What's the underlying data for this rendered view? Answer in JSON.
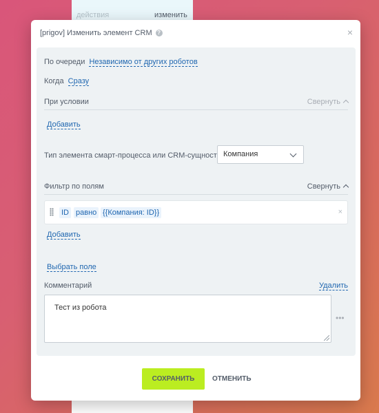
{
  "background": {
    "actions_label": "действия",
    "change_label": "изменить"
  },
  "dialog": {
    "title": "[prigov] Изменить элемент CRM",
    "help_icon": "?",
    "close_icon": "×"
  },
  "queue": {
    "label": "По очереди",
    "value": "Независимо от других роботов"
  },
  "when": {
    "label": "Когда",
    "value": "Сразу"
  },
  "condition": {
    "title": "При условии",
    "collapse_label": "Свернуть",
    "add_label": "Добавить"
  },
  "element_type": {
    "label": "Тип элемента смарт-процесса или CRM-сущности:",
    "selected": "Компания"
  },
  "filter": {
    "title": "Фильтр по полям",
    "collapse_label": "Свернуть",
    "field": "ID",
    "operator": "равно",
    "value": "{{Компания: ID}}",
    "remove_icon": "×",
    "add_label": "Добавить"
  },
  "choose_field_label": "Выбрать поле",
  "comment": {
    "label": "Комментарий",
    "delete_label": "Удалить",
    "value": "Тест из робота",
    "more_icon": "•••"
  },
  "buttons": {
    "save": "СОХРАНИТЬ",
    "cancel": "ОТМЕНИТЬ"
  },
  "colors": {
    "accent": "#bbed21",
    "link": "#2067b0",
    "panel": "#eef2f4"
  }
}
